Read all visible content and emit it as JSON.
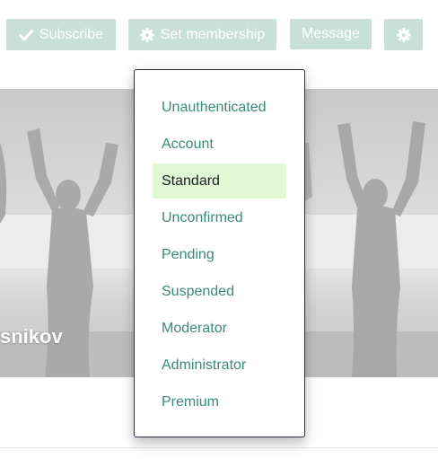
{
  "toolbar": {
    "subscribe_label": "Subscribe",
    "membership_label": "Set membership",
    "message_label": "Message",
    "settings_icon": "gear-icon"
  },
  "profile": {
    "name_fragment": "snikov"
  },
  "membership_menu": {
    "selected": "Standard",
    "items": [
      "Unauthenticated",
      "Account",
      "Standard",
      "Unconfirmed",
      "Pending",
      "Suspended",
      "Moderator",
      "Administrator",
      "Premium"
    ]
  },
  "colors": {
    "accent": "#3a8a79",
    "button_bg": "#c8e0d8",
    "selected_bg": "#e1f8d5"
  }
}
